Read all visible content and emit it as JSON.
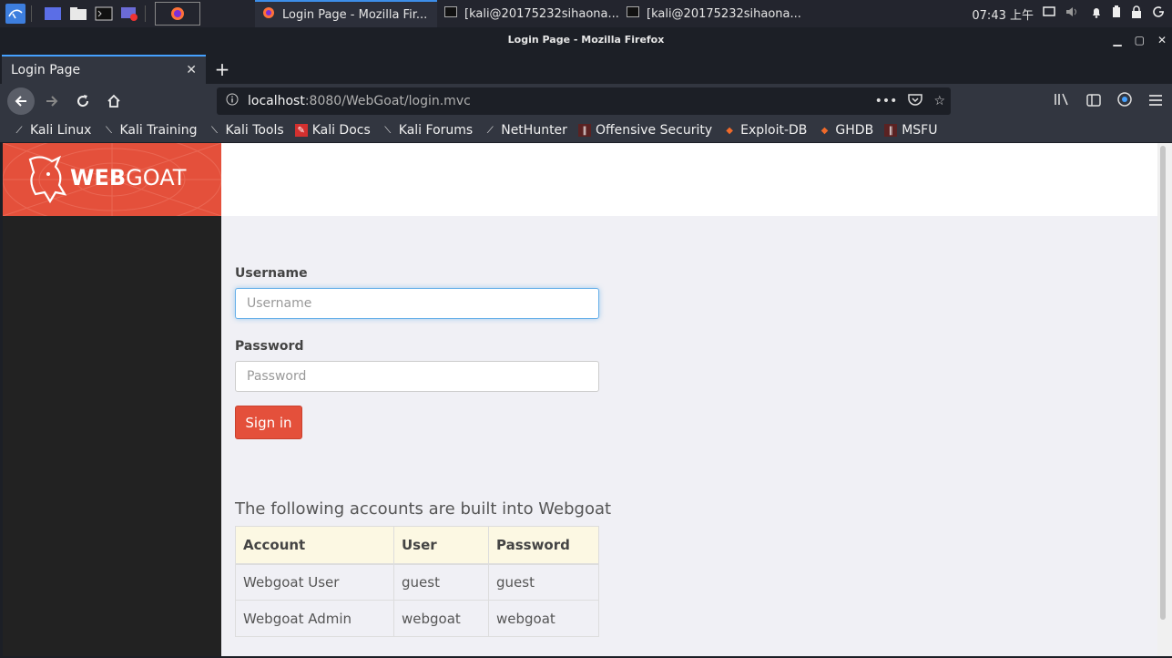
{
  "taskbar": {
    "tasks": [
      {
        "label": "Login Page - Mozilla Fir..."
      },
      {
        "label": "[kali@20175232sihaona..."
      },
      {
        "label": "[kali@20175232sihaona..."
      }
    ],
    "clock": "07:43 上午"
  },
  "window": {
    "title": "Login Page - Mozilla Firefox"
  },
  "browser": {
    "tab_title": "Login Page",
    "url_host": "localhost",
    "url_rest": ":8080/WebGoat/login.mvc",
    "bookmarks": [
      {
        "label": "Kali Linux",
        "icon": "kali-dragon-icon"
      },
      {
        "label": "Kali Training",
        "icon": "kali-dragon-icon"
      },
      {
        "label": "Kali Tools",
        "icon": "kali-dragon-icon"
      },
      {
        "label": "Kali Docs",
        "icon": "kali-docs-icon"
      },
      {
        "label": "Kali Forums",
        "icon": "kali-dragon-icon"
      },
      {
        "label": "NetHunter",
        "icon": "nethunter-icon"
      },
      {
        "label": "Offensive Security",
        "icon": "offsec-icon"
      },
      {
        "label": "Exploit-DB",
        "icon": "exploitdb-icon"
      },
      {
        "label": "GHDB",
        "icon": "exploitdb-icon"
      },
      {
        "label": "MSFU",
        "icon": "offsec-icon"
      }
    ]
  },
  "brand": {
    "name_bold": "WEB",
    "name_light": "GOAT"
  },
  "login": {
    "username_label": "Username",
    "username_placeholder": "Username",
    "password_label": "Password",
    "password_placeholder": "Password",
    "signin_label": "Sign in"
  },
  "accounts": {
    "title": "The following accounts are built into Webgoat",
    "headers": [
      "Account",
      "User",
      "Password"
    ],
    "rows": [
      [
        "Webgoat User",
        "guest",
        "guest"
      ],
      [
        "Webgoat Admin",
        "webgoat",
        "webgoat"
      ]
    ]
  },
  "colors": {
    "accent": "#e4503b",
    "sidebar": "#222222",
    "browser_chrome": "#323640"
  }
}
